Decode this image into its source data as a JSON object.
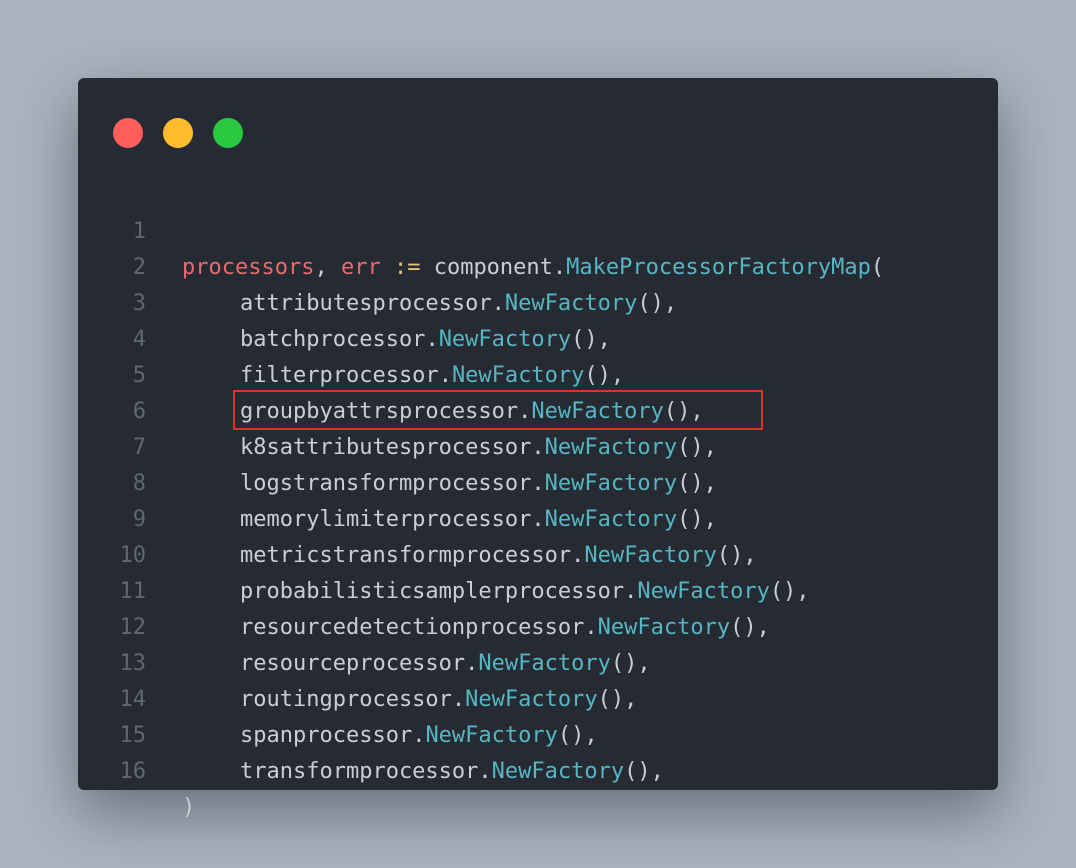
{
  "window": {
    "controls": [
      "close",
      "minimize",
      "maximize"
    ]
  },
  "code": {
    "header": {
      "var1": "processors",
      "comma": ",",
      "var2": "err",
      "op": ":=",
      "pkg": "component",
      "fn": "MakeProcessorFactoryMap",
      "paren": "("
    },
    "factory_call": "NewFactory",
    "call_suffix": "(),",
    "packages": [
      "attributesprocessor",
      "batchprocessor",
      "filterprocessor",
      "groupbyattrsprocessor",
      "k8sattributesprocessor",
      "logstransformprocessor",
      "memorylimiterprocessor",
      "metricstransformprocessor",
      "probabilisticsamplerprocessor",
      "resourcedetectionprocessor",
      "resourceprocessor",
      "routingprocessor",
      "spanprocessor",
      "transformprocessor"
    ],
    "closing": ")",
    "line_numbers": [
      "1",
      "2",
      "3",
      "4",
      "5",
      "6",
      "7",
      "8",
      "9",
      "10",
      "11",
      "12",
      "13",
      "14",
      "15",
      "16"
    ],
    "highlighted_line": 7
  },
  "colors": {
    "background": "#a9b4bf",
    "window": "#262b33",
    "variable": "#e86a6f",
    "operator": "#e5c07b",
    "function": "#56b6c2",
    "highlight_border": "#e0321f"
  }
}
